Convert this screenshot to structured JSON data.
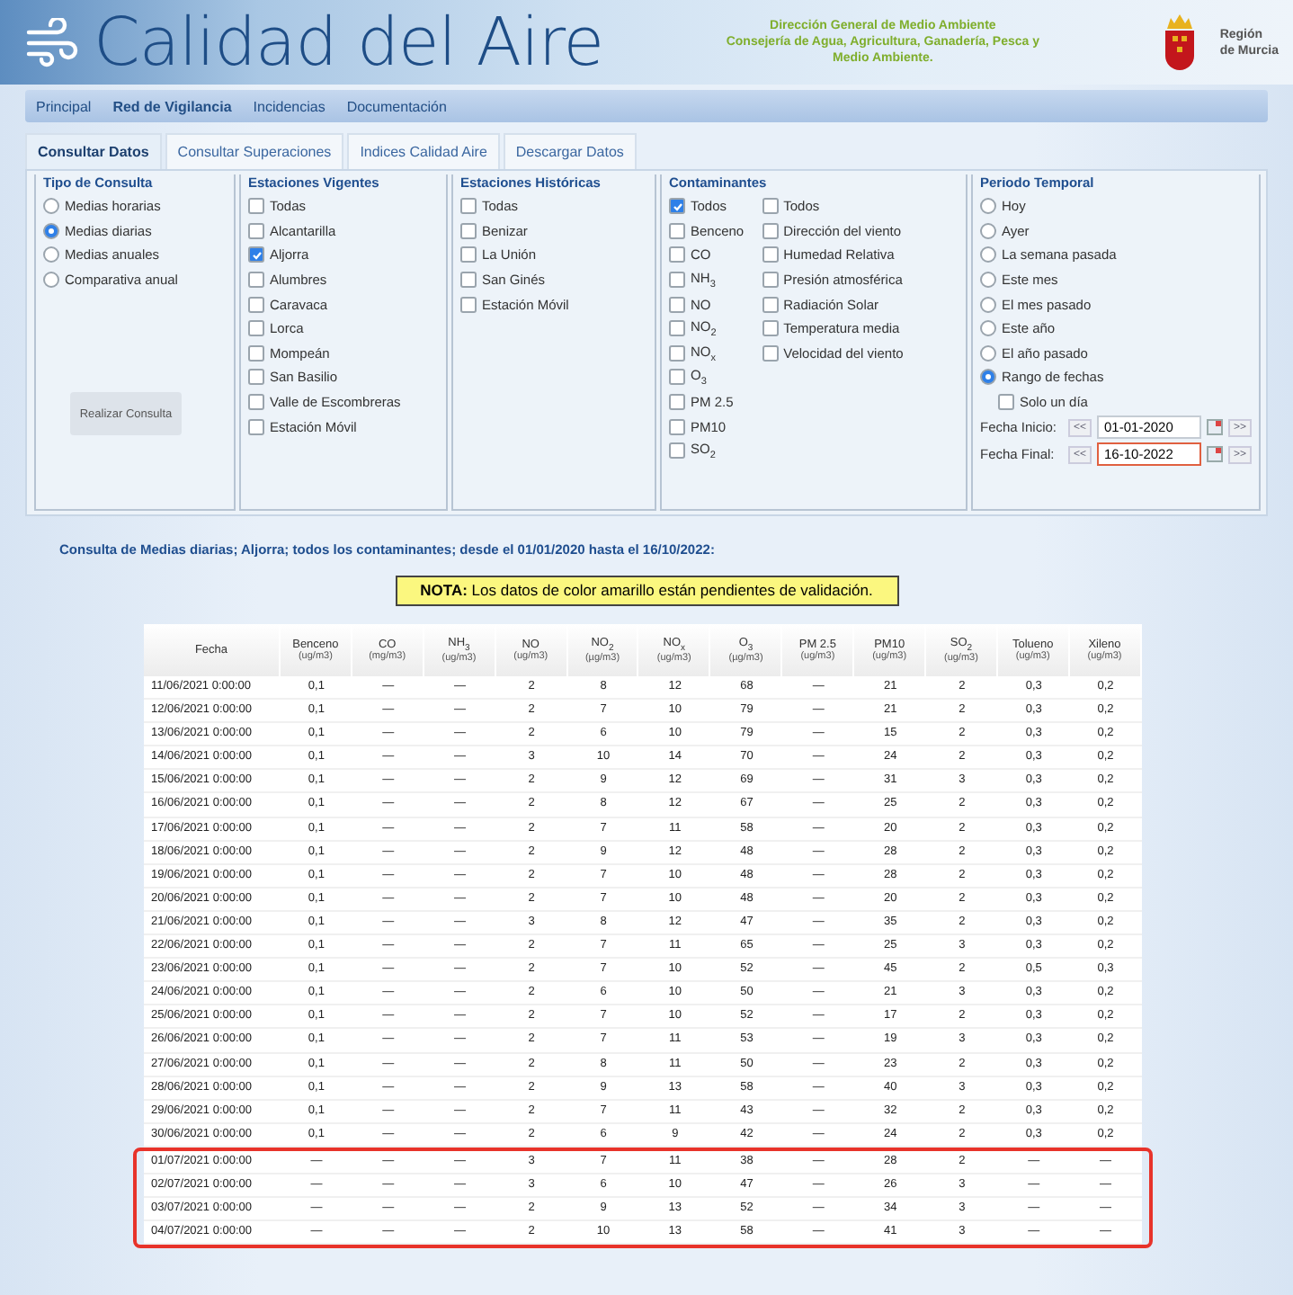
{
  "header": {
    "title": "Calidad del Aire",
    "agency_lines": [
      "Dirección General de Medio Ambiente",
      "Consejería de Agua, Agricultura, Ganadería, Pesca y",
      "Medio Ambiente."
    ],
    "region": [
      "Región",
      "de Murcia"
    ]
  },
  "nav": [
    {
      "label": "Principal",
      "selected": false
    },
    {
      "label": "Red de Vigilancia",
      "selected": true
    },
    {
      "label": "Incidencias",
      "selected": false
    },
    {
      "label": "Documentación",
      "selected": false
    }
  ],
  "tabs": [
    {
      "label": "Consultar Datos",
      "selected": true
    },
    {
      "label": "Consultar Superaciones",
      "selected": false
    },
    {
      "label": "Indices Calidad Aire",
      "selected": false
    },
    {
      "label": "Descargar Datos",
      "selected": false
    }
  ],
  "tipo_consulta": {
    "title": "Tipo de Consulta",
    "options": [
      {
        "label": "Medias horarias",
        "selected": false
      },
      {
        "label": "Medias diarias",
        "selected": true
      },
      {
        "label": "Medias anuales",
        "selected": false
      },
      {
        "label": "Comparativa anual",
        "selected": false
      }
    ],
    "button": "Realizar Consulta"
  },
  "estaciones_vigentes": {
    "title": "Estaciones Vigentes",
    "items": [
      {
        "label": "Todas",
        "checked": false
      },
      {
        "label": "Alcantarilla",
        "checked": false
      },
      {
        "label": "Aljorra",
        "checked": true
      },
      {
        "label": "Alumbres",
        "checked": false
      },
      {
        "label": "Caravaca",
        "checked": false
      },
      {
        "label": "Lorca",
        "checked": false
      },
      {
        "label": "Mompeán",
        "checked": false
      },
      {
        "label": "San Basilio",
        "checked": false
      },
      {
        "label": "Valle de Escombreras",
        "checked": false
      },
      {
        "label": "Estación Móvil",
        "checked": false
      }
    ]
  },
  "estaciones_historicas": {
    "title": "Estaciones Históricas",
    "items": [
      {
        "label": "Todas",
        "checked": false
      },
      {
        "label": "Benizar",
        "checked": false
      },
      {
        "label": "La Unión",
        "checked": false
      },
      {
        "label": "San Ginés",
        "checked": false
      },
      {
        "label": "Estación Móvil",
        "checked": false
      }
    ]
  },
  "contaminantes": {
    "title": "Contaminantes",
    "column_1": [
      {
        "label": "Todos",
        "checked": true
      },
      {
        "label": "Benceno",
        "checked": false
      },
      {
        "label": "CO",
        "checked": false
      },
      {
        "label": "NH$_{3}$",
        "checked": false
      },
      {
        "label": "NO",
        "checked": false
      },
      {
        "label": "NO$_{2}$",
        "checked": false
      },
      {
        "label": "NO$_{x}$",
        "checked": false
      },
      {
        "label": "O$_{3}$",
        "checked": false
      },
      {
        "label": "PM 2.5",
        "checked": false
      },
      {
        "label": "PM10",
        "checked": false
      },
      {
        "label": "SO$_{2}$",
        "checked": false
      }
    ],
    "column_2": [
      {
        "label": "Todos",
        "checked": false
      },
      {
        "label": "Dirección del viento",
        "checked": false
      },
      {
        "label": "Humedad Relativa",
        "checked": false
      },
      {
        "label": "Presión atmosférica",
        "checked": false
      },
      {
        "label": "Radiación Solar",
        "checked": false
      },
      {
        "label": "Temperatura media",
        "checked": false
      },
      {
        "label": "Velocidad del viento",
        "checked": false
      }
    ]
  },
  "periodo": {
    "title": "Periodo Temporal",
    "options": [
      {
        "label": "Hoy",
        "selected": false
      },
      {
        "label": "Ayer",
        "selected": false
      },
      {
        "label": "La semana pasada",
        "selected": false
      },
      {
        "label": "Este mes",
        "selected": false
      },
      {
        "label": "El mes pasado",
        "selected": false
      },
      {
        "label": "Este año",
        "selected": false
      },
      {
        "label": "El año pasado",
        "selected": false
      },
      {
        "label": "Rango de fechas",
        "selected": true
      }
    ],
    "single_day": {
      "label": "Solo un día",
      "checked": false
    },
    "dates": [
      {
        "label": "Fecha Inicio:",
        "prev": "<<",
        "value": "01-01-2020",
        "next": ">>",
        "focused": false
      },
      {
        "label": "Fecha Final:",
        "prev": "<<",
        "value": "16-10-2022",
        "next": ">>",
        "focused": true
      }
    ]
  },
  "query_summary": "Consulta de Medias diarias; Aljorra; todos los contaminantes; desde el 01/01/2020 hasta el 16/10/2022:",
  "note": "**NOTA:** Los datos de color amarillo están pendientes de validación.",
  "table": {
    "columns": [
      {
        "label": "Fecha"
      },
      {
        "label": "Benceno",
        "unit": "(ug/m3)"
      },
      {
        "label": "CO",
        "unit": "(mg/m3)"
      },
      {
        "label": "NH$_{3}$",
        "unit": "(ug/m3)"
      },
      {
        "label": "NO",
        "unit": "(ug/m3)"
      },
      {
        "label": "NO$_{2}$",
        "unit": "(µg/m3)"
      },
      {
        "label": "NO$_{x}$",
        "unit": "(ug/m3)"
      },
      {
        "label": "O$_{3}$",
        "unit": "(µg/m3)"
      },
      {
        "label": "PM 2.5",
        "unit": "(ug/m3)"
      },
      {
        "label": "PM10",
        "unit": "(ug/m3)"
      },
      {
        "label": "SO$_{2}$",
        "unit": "(ug/m3)"
      },
      {
        "label": "Tolueno",
        "unit": "(ug/m3)"
      },
      {
        "label": "Xileno",
        "unit": "(ug/m3)"
      }
    ],
    "rows": [
      {
        "highlighted": false,
        "cells": [
          "11/06/2021 0:00:00",
          "0,1",
          "—",
          "—",
          "2",
          "8",
          "12",
          "68",
          "—",
          "21",
          "2",
          "0,3",
          "0,2"
        ]
      },
      {
        "highlighted": false,
        "cells": [
          "12/06/2021 0:00:00",
          "0,1",
          "—",
          "—",
          "2",
          "7",
          "10",
          "79",
          "—",
          "21",
          "2",
          "0,3",
          "0,2"
        ]
      },
      {
        "highlighted": false,
        "cells": [
          "13/06/2021 0:00:00",
          "0,1",
          "—",
          "—",
          "2",
          "6",
          "10",
          "79",
          "—",
          "15",
          "2",
          "0,3",
          "0,2"
        ]
      },
      {
        "highlighted": false,
        "cells": [
          "14/06/2021 0:00:00",
          "0,1",
          "—",
          "—",
          "3",
          "10",
          "14",
          "70",
          "—",
          "24",
          "2",
          "0,3",
          "0,2"
        ]
      },
      {
        "highlighted": false,
        "cells": [
          "15/06/2021 0:00:00",
          "0,1",
          "—",
          "—",
          "2",
          "9",
          "12",
          "69",
          "—",
          "31",
          "3",
          "0,3",
          "0,2"
        ]
      },
      {
        "highlighted": false,
        "cells": [
          "16/06/2021 0:00:00",
          "0,1",
          "—",
          "—",
          "2",
          "8",
          "12",
          "67",
          "—",
          "25",
          "2",
          "0,3",
          "0,2"
        ]
      },
      {
        "highlighted": false,
        "cells": [
          "17/06/2021 0:00:00",
          "0,1",
          "—",
          "—",
          "2",
          "7",
          "11",
          "58",
          "—",
          "20",
          "2",
          "0,3",
          "0,2"
        ]
      },
      {
        "highlighted": false,
        "cells": [
          "18/06/2021 0:00:00",
          "0,1",
          "—",
          "—",
          "2",
          "9",
          "12",
          "48",
          "—",
          "28",
          "2",
          "0,3",
          "0,2"
        ]
      },
      {
        "highlighted": false,
        "cells": [
          "19/06/2021 0:00:00",
          "0,1",
          "—",
          "—",
          "2",
          "7",
          "10",
          "48",
          "—",
          "28",
          "2",
          "0,3",
          "0,2"
        ]
      },
      {
        "highlighted": false,
        "cells": [
          "20/06/2021 0:00:00",
          "0,1",
          "—",
          "—",
          "2",
          "7",
          "10",
          "48",
          "—",
          "20",
          "2",
          "0,3",
          "0,2"
        ]
      },
      {
        "highlighted": false,
        "cells": [
          "21/06/2021 0:00:00",
          "0,1",
          "—",
          "—",
          "3",
          "8",
          "12",
          "47",
          "—",
          "35",
          "2",
          "0,3",
          "0,2"
        ]
      },
      {
        "highlighted": false,
        "cells": [
          "22/06/2021 0:00:00",
          "0,1",
          "—",
          "—",
          "2",
          "7",
          "11",
          "65",
          "—",
          "25",
          "3",
          "0,3",
          "0,2"
        ]
      },
      {
        "highlighted": false,
        "cells": [
          "23/06/2021 0:00:00",
          "0,1",
          "—",
          "—",
          "2",
          "7",
          "10",
          "52",
          "—",
          "45",
          "2",
          "0,5",
          "0,3"
        ]
      },
      {
        "highlighted": false,
        "cells": [
          "24/06/2021 0:00:00",
          "0,1",
          "—",
          "—",
          "2",
          "6",
          "10",
          "50",
          "—",
          "21",
          "3",
          "0,3",
          "0,2"
        ]
      },
      {
        "highlighted": false,
        "cells": [
          "25/06/2021 0:00:00",
          "0,1",
          "—",
          "—",
          "2",
          "7",
          "10",
          "52",
          "—",
          "17",
          "2",
          "0,3",
          "0,2"
        ]
      },
      {
        "highlighted": false,
        "cells": [
          "26/06/2021 0:00:00",
          "0,1",
          "—",
          "—",
          "2",
          "7",
          "11",
          "53",
          "—",
          "19",
          "3",
          "0,3",
          "0,2"
        ]
      },
      {
        "highlighted": false,
        "cells": [
          "27/06/2021 0:00:00",
          "0,1",
          "—",
          "—",
          "2",
          "8",
          "11",
          "50",
          "—",
          "23",
          "2",
          "0,3",
          "0,2"
        ]
      },
      {
        "highlighted": false,
        "cells": [
          "28/06/2021 0:00:00",
          "0,1",
          "—",
          "—",
          "2",
          "9",
          "13",
          "58",
          "—",
          "40",
          "3",
          "0,3",
          "0,2"
        ]
      },
      {
        "highlighted": false,
        "cells": [
          "29/06/2021 0:00:00",
          "0,1",
          "—",
          "—",
          "2",
          "7",
          "11",
          "43",
          "—",
          "32",
          "2",
          "0,3",
          "0,2"
        ]
      },
      {
        "highlighted": false,
        "cells": [
          "30/06/2021 0:00:00",
          "0,1",
          "—",
          "—",
          "2",
          "6",
          "9",
          "42",
          "—",
          "24",
          "2",
          "0,3",
          "0,2"
        ]
      },
      {
        "highlighted": true,
        "cells": [
          "01/07/2021 0:00:00",
          "—",
          "—",
          "—",
          "3",
          "7",
          "11",
          "38",
          "—",
          "28",
          "2",
          "—",
          "—"
        ]
      },
      {
        "highlighted": true,
        "cells": [
          "02/07/2021 0:00:00",
          "—",
          "—",
          "—",
          "3",
          "6",
          "10",
          "47",
          "—",
          "26",
          "3",
          "—",
          "—"
        ]
      },
      {
        "highlighted": true,
        "cells": [
          "03/07/2021 0:00:00",
          "—",
          "—",
          "—",
          "2",
          "9",
          "13",
          "52",
          "—",
          "34",
          "3",
          "—",
          "—"
        ]
      },
      {
        "highlighted": true,
        "cells": [
          "04/07/2021 0:00:00",
          "—",
          "—",
          "—",
          "2",
          "10",
          "13",
          "58",
          "—",
          "41",
          "3",
          "—",
          "—"
        ]
      }
    ]
  }
}
